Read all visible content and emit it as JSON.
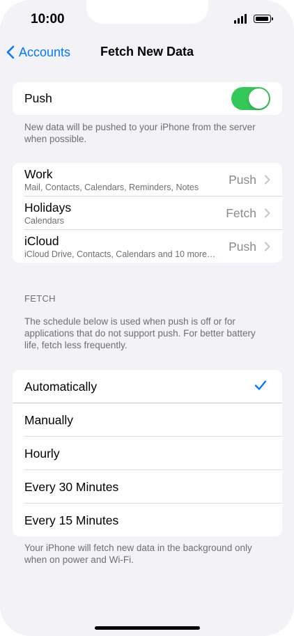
{
  "status_bar": {
    "time": "10:00",
    "signal_icon": "cellular-signal-icon",
    "battery_icon": "battery-icon"
  },
  "nav": {
    "back_label": "Accounts",
    "title": "Fetch New Data"
  },
  "push": {
    "label": "Push",
    "toggle_on": true,
    "toggle_color": "#34c759",
    "footnote": "New data will be pushed to your iPhone from the server when possible."
  },
  "accounts": [
    {
      "name": "Work",
      "detail": "Mail, Contacts, Calendars, Reminders, Notes",
      "value": "Push"
    },
    {
      "name": "Holidays",
      "detail": "Calendars",
      "value": "Fetch"
    },
    {
      "name": "iCloud",
      "detail": "iCloud Drive, Contacts, Calendars and 10 more…",
      "value": "Push"
    }
  ],
  "fetch": {
    "header": "FETCH",
    "description": "The schedule below is used when push is off or for applications that do not support push. For better battery life, fetch less frequently.",
    "options": [
      {
        "label": "Automatically",
        "selected": true
      },
      {
        "label": "Manually",
        "selected": false
      },
      {
        "label": "Hourly",
        "selected": false
      },
      {
        "label": "Every 30 Minutes",
        "selected": false
      },
      {
        "label": "Every 15 Minutes",
        "selected": false
      }
    ],
    "footnote": "Your iPhone will fetch new data in the background only when on power and Wi-Fi."
  },
  "accent_color": "#007aff"
}
